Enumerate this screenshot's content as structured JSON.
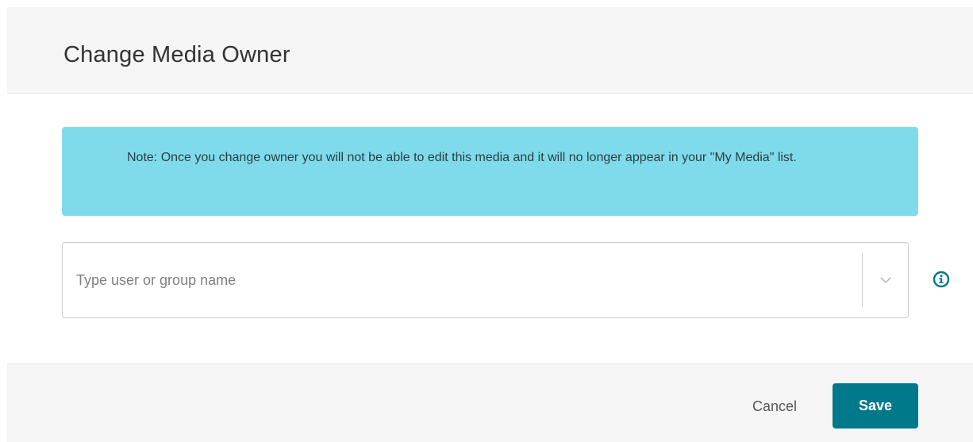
{
  "dialog": {
    "title": "Change Media Owner"
  },
  "note": {
    "text": "Note: Once you change owner you will not be able to edit this media and it will no longer appear in your \"My Media\" list."
  },
  "owner_select": {
    "value": "",
    "placeholder": "Type user or group name",
    "toggle_icon": "chevron-down-icon",
    "info_icon": "info-icon"
  },
  "footer": {
    "cancel_label": "Cancel",
    "save_label": "Save"
  },
  "colors": {
    "header_bg": "#f5f5f5",
    "note_bg": "#7fdbeb",
    "save_bg": "#00798a",
    "info_icon": "#00798a"
  }
}
